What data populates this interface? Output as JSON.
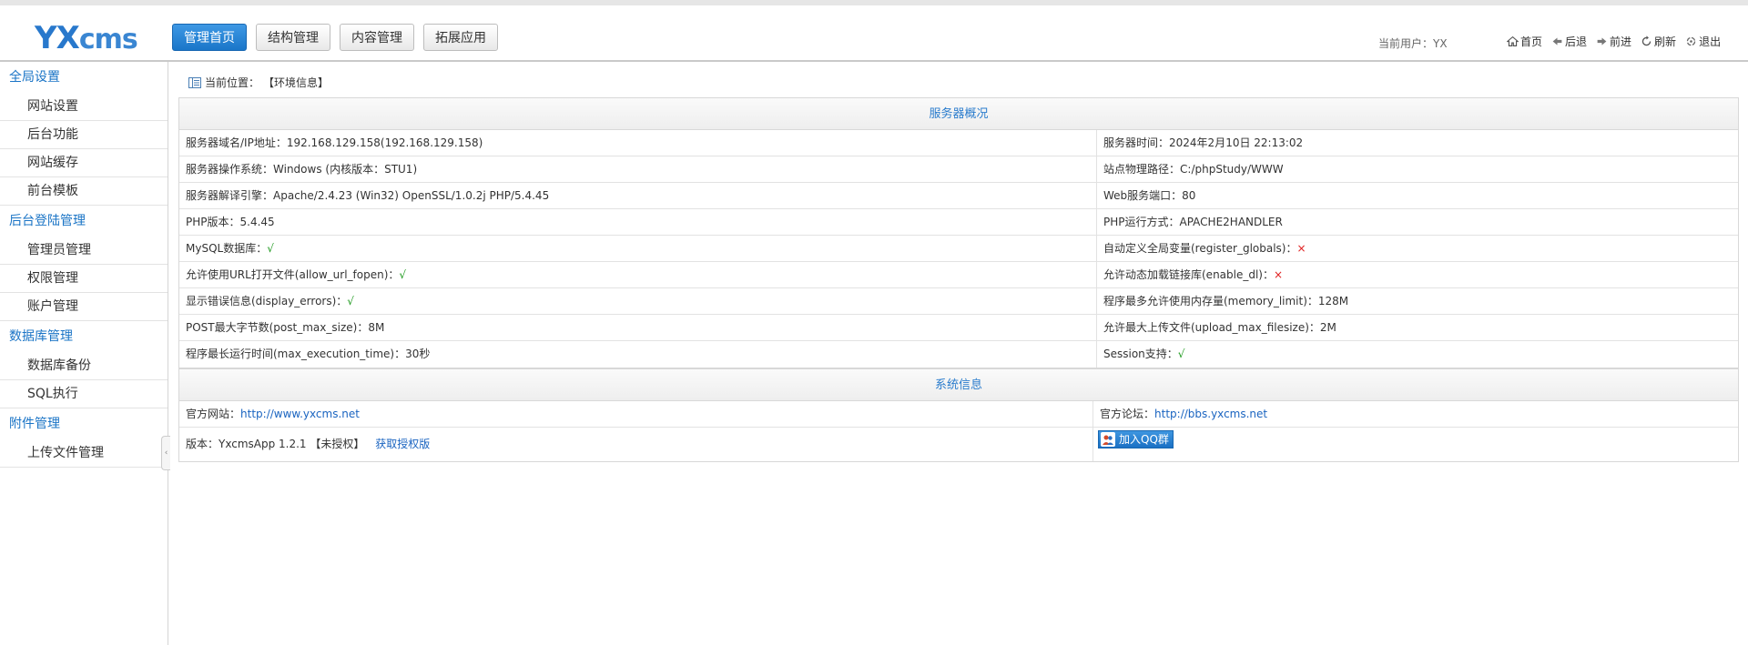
{
  "header": {
    "logo": {
      "yx": "YX",
      "cms": "cms"
    },
    "nav": [
      {
        "label": "管理首页",
        "active": true
      },
      {
        "label": "结构管理",
        "active": false
      },
      {
        "label": "内容管理",
        "active": false
      },
      {
        "label": "拓展应用",
        "active": false
      }
    ],
    "current_user": "当前用户：YX",
    "actions": [
      {
        "label": "首页",
        "icon": "home-icon"
      },
      {
        "label": "后退",
        "icon": "back-arrow-icon"
      },
      {
        "label": "前进",
        "icon": "forward-arrow-icon"
      },
      {
        "label": "刷新",
        "icon": "refresh-icon"
      },
      {
        "label": "退出",
        "icon": "logout-icon"
      }
    ]
  },
  "sidebar": {
    "groups": [
      {
        "title": "全局设置",
        "items": [
          "网站设置",
          "后台功能",
          "网站缓存",
          "前台模板"
        ]
      },
      {
        "title": "后台登陆管理",
        "items": [
          "管理员管理",
          "权限管理",
          "账户管理"
        ]
      },
      {
        "title": "数据库管理",
        "items": [
          "数据库备份",
          "SQL执行"
        ]
      },
      {
        "title": "附件管理",
        "items": [
          "上传文件管理"
        ]
      }
    ],
    "toggle": "‹"
  },
  "breadcrumb": {
    "label": "当前位置：",
    "current": "【环境信息】"
  },
  "server": {
    "title": "服务器概况",
    "rows": [
      {
        "left_label": "服务器域名/IP地址：",
        "left_value": "192.168.129.158(192.168.129.158)",
        "right_label": "服务器时间：",
        "right_value": "2024年2月10日 22:13:02"
      },
      {
        "left_label": "服务器操作系统：",
        "left_value": "Windows (内核版本：STU1)",
        "right_label": "站点物理路径：",
        "right_value": "C:/phpStudy/WWW"
      },
      {
        "left_label": "服务器解译引擎：",
        "left_value": "Apache/2.4.23 (Win32) OpenSSL/1.0.2j PHP/5.4.45",
        "right_label": "Web服务端口：",
        "right_value": "80"
      },
      {
        "left_label": "PHP版本：",
        "left_value": "5.4.45",
        "right_label": "PHP运行方式：",
        "right_value": "APACHE2HANDLER"
      },
      {
        "left_label": "MySQL数据库：",
        "left_value": "√",
        "left_status": "ok",
        "right_label": "自动定义全局变量(register_globals)：",
        "right_value": "×",
        "right_status": "no"
      },
      {
        "left_label": "允许使用URL打开文件(allow_url_fopen)：",
        "left_value": "√",
        "left_status": "ok",
        "right_label": "允许动态加载链接库(enable_dl)：",
        "right_value": "×",
        "right_status": "no"
      },
      {
        "left_label": "显示错误信息(display_errors)：",
        "left_value": "√",
        "left_status": "ok",
        "right_label": "程序最多允许使用内存量(memory_limit)：",
        "right_value": "128M"
      },
      {
        "left_label": "POST最大字节数(post_max_size)：",
        "left_value": "8M",
        "right_label": "允许最大上传文件(upload_max_filesize)：",
        "right_value": "2M"
      },
      {
        "left_label": "程序最长运行时间(max_execution_time)：",
        "left_value": "30秒",
        "right_label": "Session支持：",
        "right_value": "√",
        "right_status": "ok"
      }
    ]
  },
  "system": {
    "title": "系统信息",
    "official_site_label": "官方网站：",
    "official_site_url": "http://www.yxcms.net",
    "forum_label": "官方论坛：",
    "forum_url": "http://bbs.yxcms.net",
    "version_label": "版本：",
    "version_value": "YxcmsApp 1.2.1 【未授权】",
    "license_link": "获取授权版",
    "qq_button": "加入QQ群"
  }
}
